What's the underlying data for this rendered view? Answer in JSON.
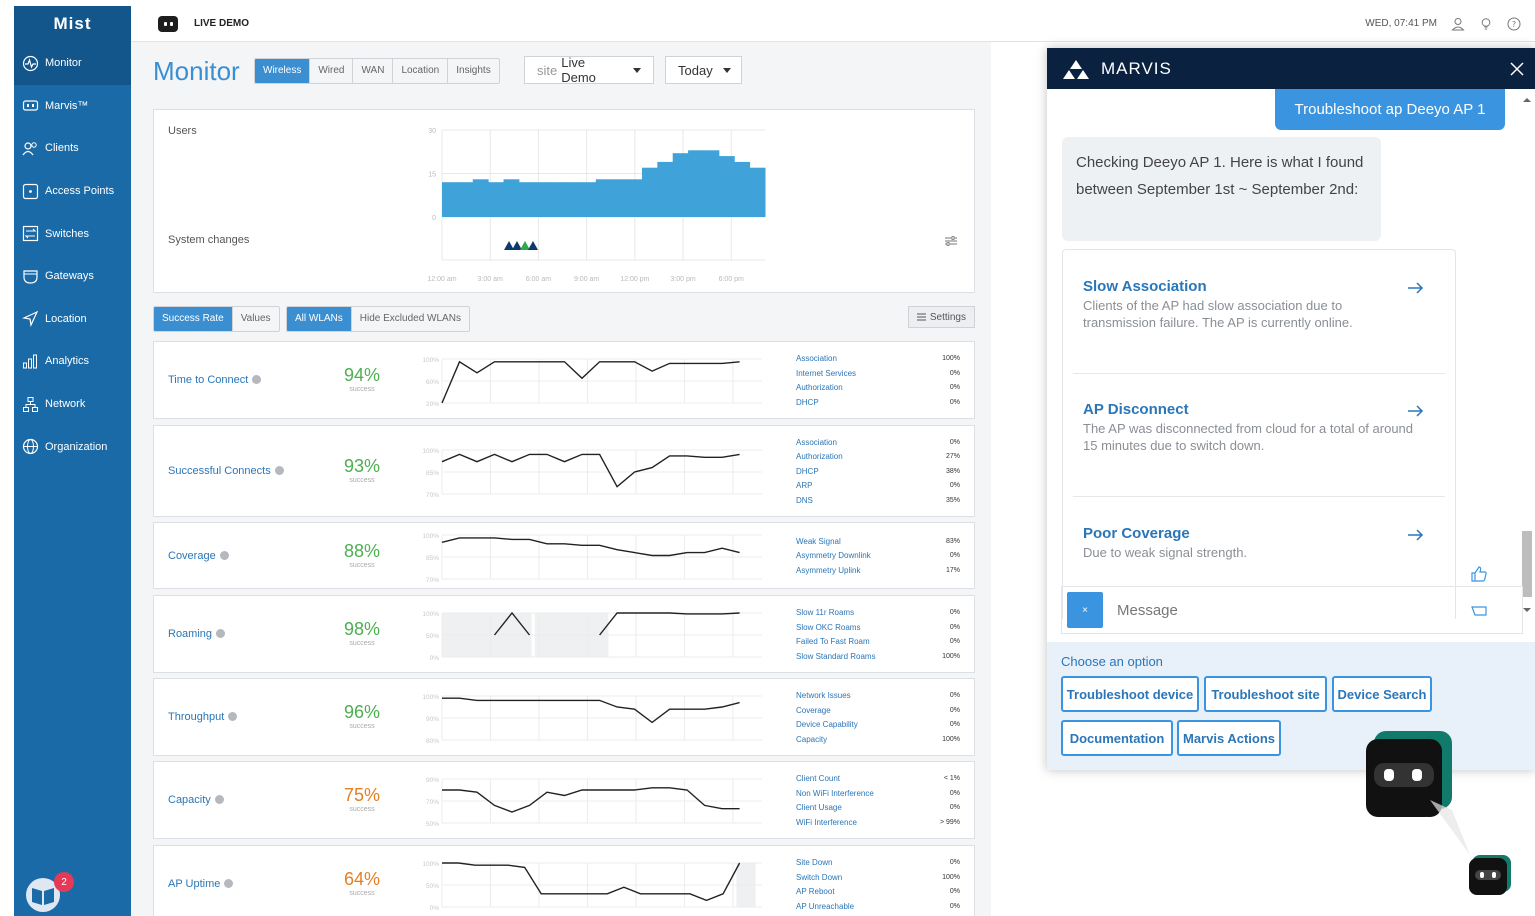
{
  "app": {
    "logo": "Mist",
    "org_name": "LIVE DEMO",
    "datetime": "WED, 07:41 PM"
  },
  "sidebar": {
    "items": [
      {
        "label": "Monitor",
        "icon": "monitor-icon"
      },
      {
        "label": "Marvis™",
        "icon": "marvis-icon"
      },
      {
        "label": "Clients",
        "icon": "clients-icon"
      },
      {
        "label": "Access Points",
        "icon": "access-point-icon"
      },
      {
        "label": "Switches",
        "icon": "switch-icon"
      },
      {
        "label": "Gateways",
        "icon": "gateway-icon"
      },
      {
        "label": "Location",
        "icon": "location-icon"
      },
      {
        "label": "Analytics",
        "icon": "analytics-icon"
      },
      {
        "label": "Network",
        "icon": "network-icon"
      },
      {
        "label": "Organization",
        "icon": "organization-icon"
      }
    ],
    "help_badge": "2"
  },
  "monitor": {
    "title": "Monitor",
    "tabs": [
      "Wireless",
      "Wired",
      "WAN",
      "Location",
      "Insights"
    ],
    "site_prefix": "site",
    "site_value": "Live Demo",
    "time_range": "Today",
    "users_label": "Users",
    "system_changes_label": "System changes",
    "y_ticks": [
      "30",
      "15",
      "0"
    ],
    "x_ticks": [
      "12:00 am",
      "3:00 am",
      "6:00 am",
      "9:00 am",
      "12:00 pm",
      "3:00 pm",
      "6:00 pm"
    ],
    "users_values": [
      12,
      12,
      13,
      12,
      13,
      12,
      12,
      12,
      12,
      12,
      13,
      13,
      13,
      17,
      19,
      22,
      23,
      23,
      21,
      19,
      17
    ],
    "mode_buttons": [
      "Success Rate",
      "Values"
    ],
    "wlan_buttons": [
      "All WLANs",
      "Hide Excluded WLANs"
    ],
    "settings_label": "Settings"
  },
  "sles": [
    {
      "name": "Time to Connect",
      "pct": "94%",
      "sub": "success",
      "color": "#4caf50",
      "ticks": [
        "100%",
        "60%",
        "20%"
      ],
      "range": [
        20,
        100
      ],
      "line": [
        20,
        95,
        75,
        95,
        95,
        95,
        95,
        95,
        65,
        95,
        95,
        95,
        78,
        92,
        92,
        92,
        92,
        95
      ],
      "hatch": [],
      "cls": [
        [
          "Association",
          "100%"
        ],
        [
          "Internet Services",
          "0%"
        ],
        [
          "Authorization",
          "0%"
        ],
        [
          "DHCP",
          "0%"
        ]
      ]
    },
    {
      "name": "Successful Connects",
      "pct": "93%",
      "sub": "success",
      "color": "#4caf50",
      "ticks": [
        "100%",
        "85%",
        "70%"
      ],
      "range": [
        70,
        100
      ],
      "line": [
        92,
        97,
        92,
        97,
        92,
        97,
        97,
        92,
        97,
        97,
        75,
        85,
        88,
        96,
        96,
        95,
        95,
        97
      ],
      "hatch": [],
      "cls": [
        [
          "Association",
          "0%"
        ],
        [
          "Authorization",
          "27%"
        ],
        [
          "DHCP",
          "38%"
        ],
        [
          "ARP",
          "0%"
        ],
        [
          "DNS",
          "35%"
        ]
      ]
    },
    {
      "name": "Coverage",
      "pct": "88%",
      "sub": "success",
      "color": "#4caf50",
      "ticks": [
        "100%",
        "85%",
        "70%"
      ],
      "range": [
        70,
        100
      ],
      "line": [
        95,
        98,
        98,
        98,
        97,
        97,
        94,
        94,
        93,
        93,
        90,
        88,
        86,
        86,
        88,
        88,
        91,
        88
      ],
      "hatch": [],
      "cls": [
        [
          "Weak Signal",
          "83%"
        ],
        [
          "Asymmetry Downlink",
          "0%"
        ],
        [
          "Asymmetry Uplink",
          "17%"
        ]
      ]
    },
    {
      "name": "Roaming",
      "pct": "98%",
      "sub": "success",
      "color": "#4caf50",
      "ticks": [
        "100%",
        "50%",
        "0%"
      ],
      "range": [
        0,
        100
      ],
      "line": [
        null,
        null,
        null,
        50,
        100,
        50,
        null,
        null,
        null,
        50,
        100,
        100,
        100,
        100,
        98,
        98,
        98,
        100
      ],
      "hatch": [
        [
          0,
          0.28
        ],
        [
          0.29,
          0.52
        ]
      ],
      "cls": [
        [
          "Slow 11r Roams",
          "0%"
        ],
        [
          "Slow OKC Roams",
          "0%"
        ],
        [
          "Failed To Fast Roam",
          "0%"
        ],
        [
          "Slow Standard Roams",
          "100%"
        ]
      ]
    },
    {
      "name": "Throughput",
      "pct": "96%",
      "sub": "success",
      "color": "#4caf50",
      "ticks": [
        "100%",
        "90%",
        "80%"
      ],
      "range": [
        80,
        100
      ],
      "line": [
        99,
        99,
        98,
        98,
        98,
        98,
        98,
        98,
        98,
        98,
        95,
        94,
        88,
        94,
        94,
        94,
        95,
        97
      ],
      "hatch": [],
      "cls": [
        [
          "Network Issues",
          "0%"
        ],
        [
          "Coverage",
          "0%"
        ],
        [
          "Device Capability",
          "0%"
        ],
        [
          "Capacity",
          "100%"
        ]
      ]
    },
    {
      "name": "Capacity",
      "pct": "75%",
      "sub": "success",
      "color": "#e67e22",
      "ticks": [
        "90%",
        "70%",
        "50%"
      ],
      "range": [
        50,
        90
      ],
      "line": [
        80,
        80,
        78,
        66,
        60,
        66,
        78,
        75,
        80,
        80,
        80,
        80,
        82,
        82,
        80,
        66,
        63,
        63
      ],
      "hatch": [],
      "cls": [
        [
          "Client Count",
          "< 1%"
        ],
        [
          "Non WiFi Interference",
          "0%"
        ],
        [
          "Client Usage",
          "0%"
        ],
        [
          "WiFi Interference",
          "> 99%"
        ]
      ]
    },
    {
      "name": "AP Uptime",
      "pct": "64%",
      "sub": "success",
      "color": "#e67e22",
      "ticks": [
        "100%",
        "50%",
        "0%"
      ],
      "range": [
        0,
        100
      ],
      "line": [
        100,
        100,
        95,
        95,
        95,
        90,
        30,
        30,
        30,
        30,
        30,
        45,
        30,
        30,
        30,
        30,
        15,
        30,
        100
      ],
      "hatch": [
        [
          0.92,
          0.98
        ]
      ],
      "cls": [
        [
          "Site Down",
          "0%"
        ],
        [
          "Switch Down",
          "100%"
        ],
        [
          "AP Reboot",
          "0%"
        ],
        [
          "AP Unreachable",
          "0%"
        ]
      ]
    }
  ],
  "marvis": {
    "title": "MARVIS",
    "user_message": "Troubleshoot ap Deeyo AP 1",
    "bot_message": "Checking Deeyo AP 1. Here is what I found between September 1st ~ September 2nd:",
    "results": [
      {
        "title": "Slow Association",
        "desc": "Clients of the AP had slow association due to transmission failure. The AP is currently online."
      },
      {
        "title": "AP Disconnect",
        "desc": "The AP was disconnected from cloud for a total of around 15 minutes due to switch down."
      },
      {
        "title": "Poor Coverage",
        "desc": "Due to weak signal strength."
      }
    ],
    "message_placeholder": "Message",
    "message_clear": "×",
    "options_label": "Choose an option",
    "options": [
      "Troubleshoot device",
      "Troubleshoot site",
      "Device Search",
      "Documentation",
      "Marvis Actions"
    ]
  },
  "colors": {
    "sidebar": "#1a6aa8",
    "accent": "#3b8fd1",
    "chart_fill": "#3fa2d8",
    "marvis_header": "#0b2140"
  }
}
